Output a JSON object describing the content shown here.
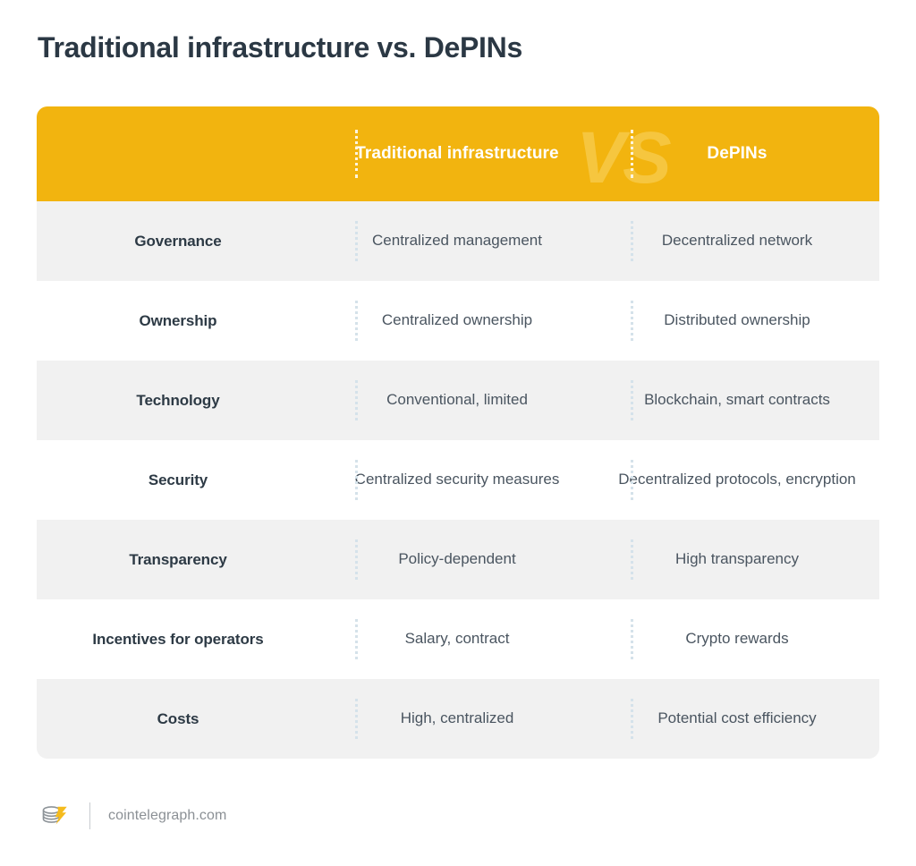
{
  "page": {
    "title": "Traditional infrastructure vs. DePINs",
    "background_color": "#ffffff"
  },
  "colors": {
    "header_gold": "#f2b40f",
    "watermark_gold": "#f6c63f",
    "row_shaded": "#f1f1f1",
    "row_plain": "#ffffff",
    "label_text": "#2d3a45",
    "value_text": "#4a5560",
    "header_text": "#ffffff",
    "divider_body": "#d5e2ea",
    "divider_header": "#fdf5e0",
    "footer_text": "#8b9095",
    "logo_bolt": "#f5bb1d",
    "logo_coin": "#8e9499"
  },
  "table": {
    "header": {
      "label_column": "",
      "col_a": "Traditional infrastructure",
      "col_b": "DePINs",
      "watermark": "VS"
    },
    "columns": [
      "",
      "Traditional infrastructure",
      "DePINs"
    ],
    "rows": [
      {
        "label": "Governance",
        "traditional": "Centralized management",
        "depins": "Decentralized network",
        "shaded": true
      },
      {
        "label": "Ownership",
        "traditional": "Centralized ownership",
        "depins": "Distributed ownership",
        "shaded": false
      },
      {
        "label": "Technology",
        "traditional": "Conventional, limited",
        "depins": "Blockchain, smart contracts",
        "shaded": true
      },
      {
        "label": "Security",
        "traditional": "Centralized security measures",
        "depins": "Decentralized protocols, encryption",
        "shaded": false
      },
      {
        "label": "Transparency",
        "traditional": "Policy-dependent",
        "depins": "High transparency",
        "shaded": true
      },
      {
        "label": "Incentives for operators",
        "traditional": "Salary, contract",
        "depins": "Crypto rewards",
        "shaded": false
      },
      {
        "label": "Costs",
        "traditional": "High, centralized",
        "depins": "Potential cost efficiency",
        "shaded": true
      }
    ]
  },
  "footer": {
    "logo_name": "cointelegraph-coin-bolt-logo",
    "site": "cointelegraph.com"
  }
}
